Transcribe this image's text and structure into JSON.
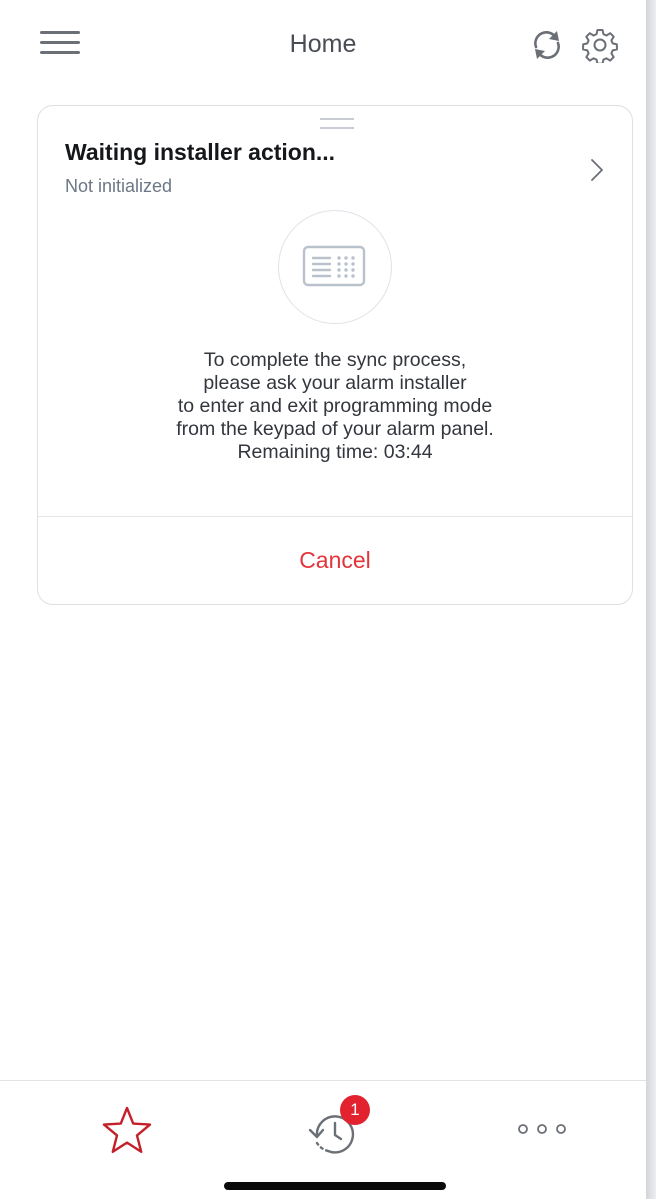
{
  "header": {
    "title": "Home",
    "menu_icon": "hamburger-menu-icon",
    "sync_icon": "refresh-icon",
    "settings_icon": "gear-icon"
  },
  "card": {
    "title": "Waiting installer action...",
    "subtitle": "Not initialized",
    "chevron_icon": "chevron-right-icon",
    "illustration_icon": "keypad-icon",
    "message_lines": [
      "To complete the sync process,",
      "please ask your alarm installer",
      "to enter and exit programming mode",
      "from the keypad of your alarm panel.",
      "Remaining time: 03:44"
    ],
    "cancel_label": "Cancel"
  },
  "tabbar": {
    "favorites_icon": "star-icon",
    "history_icon": "history-icon",
    "history_badge": "1",
    "more_icon": "more-dots-icon"
  },
  "colors": {
    "accent": "#e2343a",
    "badge": "#e2232f",
    "subtitle": "#6c7785"
  }
}
